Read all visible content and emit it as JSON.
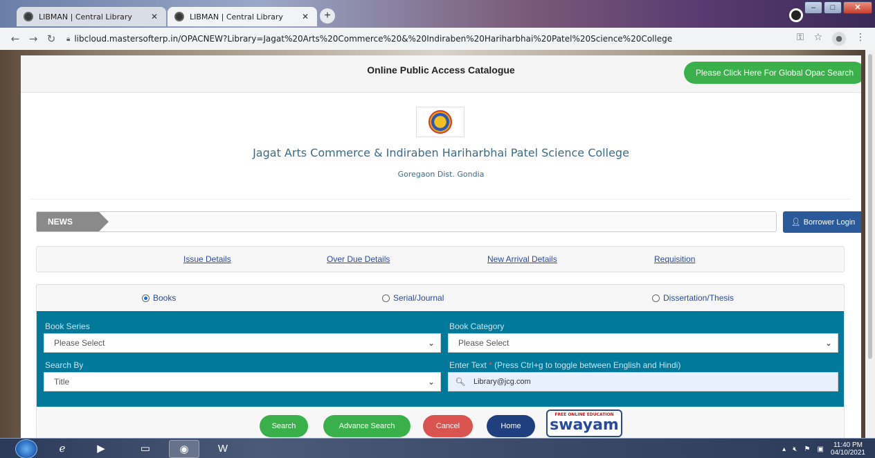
{
  "browser": {
    "tabs": [
      {
        "title": "LIBMAN | Central Library",
        "active": false
      },
      {
        "title": "LIBMAN | Central Library",
        "active": true
      }
    ],
    "url": "libcloud.mastersofterp.in/OPACNEW?Library=Jagat%20Arts%20Commerce%20&%20Indiraben%20Hariharbhai%20Patel%20Science%20College",
    "new_tab_symbol": "+"
  },
  "page": {
    "header_title": "Online Public Access Catalogue",
    "global_opac_button": "Please Click Here For Global Opac Search",
    "college_name": "Jagat Arts Commerce & Indiraben Hariharbhai Patel Science College",
    "college_location": "Goregaon Dist. Gondia",
    "news_label": "NEWS",
    "borrower_login": "Borrower Login",
    "links": [
      "Issue Details",
      "Over Due Details",
      "New Arrival Details",
      "Requisition"
    ],
    "material_types": [
      {
        "label": "Books",
        "checked": true
      },
      {
        "label": "Serial/Journal",
        "checked": false
      },
      {
        "label": "Dissertation/Thesis",
        "checked": false
      }
    ],
    "book_series": {
      "label": "Book Series",
      "value": "Please Select"
    },
    "book_category": {
      "label": "Book Category",
      "value": "Please Select"
    },
    "search_by": {
      "label": "Search By",
      "value": "Title"
    },
    "enter_text": {
      "label_prefix": "Enter Text",
      "required_mark": "*",
      "label_suffix": "(Press Ctrl+g to toggle between English and Hindi)",
      "value": "Library@jcg.com"
    },
    "buttons": {
      "search": "Search",
      "advance_search": "Advance Search",
      "cancel": "Cancel",
      "home": "Home"
    },
    "swayam_logo": {
      "text": "swayam",
      "tagline": "FREE ONLINE EDUCATION"
    }
  },
  "taskbar": {
    "time": "11:40 PM",
    "date": "04/10/2021"
  },
  "colors": {
    "accent_green": "#3ab04a",
    "search_panel_blue": "#00799b",
    "borrower_blue": "#2a5a9a",
    "cancel_red": "#d9534f",
    "home_navy": "#1f3f7f"
  }
}
